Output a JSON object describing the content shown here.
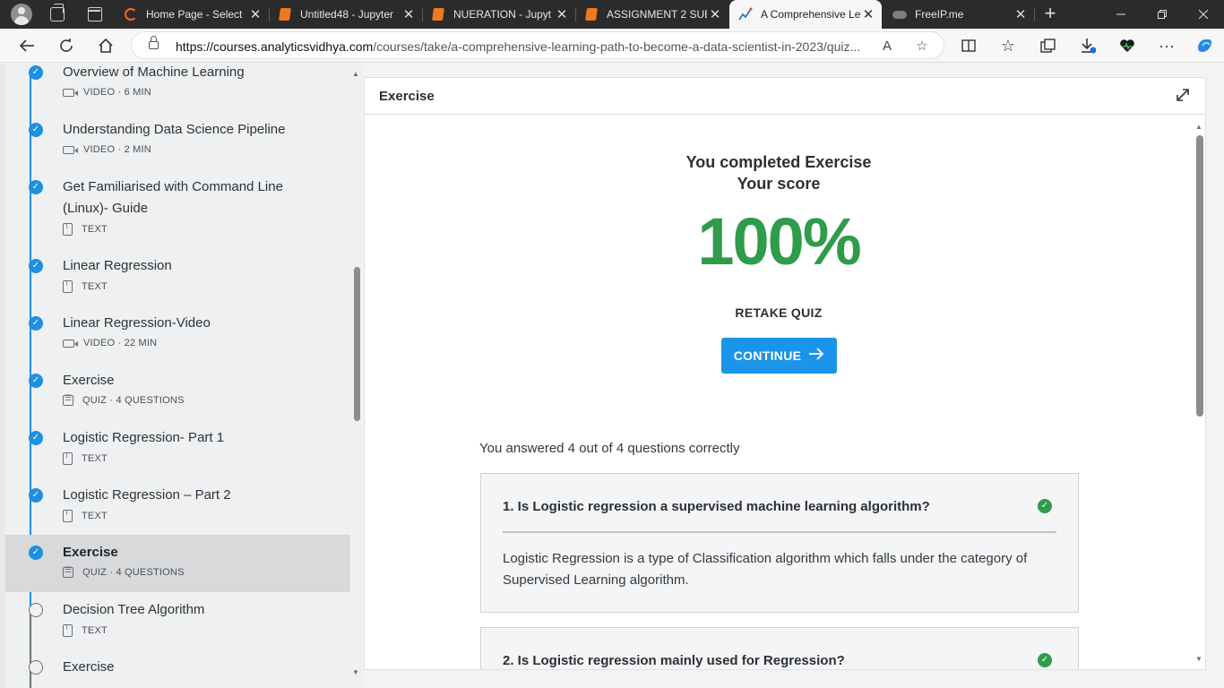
{
  "browser": {
    "tabs": [
      {
        "title": "Home Page - Select",
        "favicon": "ring-logo-icon"
      },
      {
        "title": "Untitled48 - Jupyter",
        "favicon": "jupyter-book-icon"
      },
      {
        "title": "NUERATION - Jupyt",
        "favicon": "jupyter-book-icon"
      },
      {
        "title": "ASSIGNMENT 2 SUB",
        "favicon": "jupyter-book-icon"
      },
      {
        "title": "A Comprehensive Le",
        "favicon": "chart-line-icon",
        "active": true
      },
      {
        "title": "FreeIP.me",
        "favicon": "cloud-icon"
      }
    ],
    "close_glyph": "✕",
    "new_tab_glyph": "+",
    "url_host": "https://courses.analyticsvidhya.com",
    "url_path": "/courses/take/a-comprehensive-learning-path-to-become-a-data-scientist-in-2023/quiz...",
    "accent": "#1a95e9"
  },
  "sidebar": {
    "lessons": [
      {
        "title": "Overview of Machine Learning",
        "meta": "VIDEO · 6 MIN",
        "type": "video",
        "done": true
      },
      {
        "title": "Understanding Data Science Pipeline",
        "meta": "VIDEO · 2 MIN",
        "type": "video",
        "done": true
      },
      {
        "title": "Get Familiarised with Command Line",
        "title2": "(Linux)- Guide",
        "meta": "TEXT",
        "type": "text",
        "done": true
      },
      {
        "title": "Linear Regression",
        "meta": "TEXT",
        "type": "text",
        "done": true
      },
      {
        "title": "Linear Regression-Video",
        "meta": "VIDEO · 22 MIN",
        "type": "video",
        "done": true
      },
      {
        "title": "Exercise",
        "meta": "QUIZ · 4 QUESTIONS",
        "type": "quiz",
        "done": true
      },
      {
        "title": "Logistic Regression- Part 1",
        "meta": "TEXT",
        "type": "text",
        "done": true
      },
      {
        "title": "Logistic Regression – Part 2",
        "meta": "TEXT",
        "type": "text",
        "done": true
      },
      {
        "title": "Exercise",
        "meta": "QUIZ · 4 QUESTIONS",
        "type": "quiz",
        "done": true,
        "active": true
      },
      {
        "title": "Decision Tree Algorithm",
        "meta": "TEXT",
        "type": "text",
        "done": false
      },
      {
        "title": "Exercise",
        "meta": "",
        "type": "quiz",
        "done": false
      }
    ],
    "check_color": "#1f8fe0"
  },
  "main": {
    "header_title": "Exercise",
    "completed_line1": "You completed Exercise",
    "completed_line2": "Your score",
    "score": "100%",
    "score_color": "#2e9c4a",
    "retake_label": "RETAKE QUIZ",
    "continue_label": "CONTINUE",
    "answered_text": "You answered 4 out of 4 questions correctly",
    "questions": [
      {
        "title": "1. Is Logistic regression a supervised machine learning algorithm?",
        "explanation": "Logistic Regression is a type of Classification algorithm which falls under the category of Supervised Learning algorithm.",
        "correct": true
      },
      {
        "title": "2. Is Logistic regression mainly used for Regression?",
        "explanation": "",
        "correct": true
      }
    ]
  }
}
